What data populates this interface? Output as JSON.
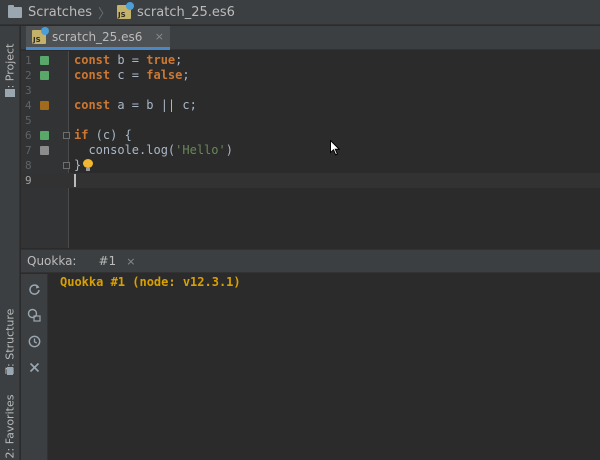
{
  "navbar": {
    "breadcrumb": [
      "Scratches",
      "scratch_25.es6"
    ]
  },
  "left_stripe": {
    "tabs": [
      "1: Project",
      "Z: Structure",
      "2: Favorites"
    ]
  },
  "editor": {
    "tab_label": "scratch_25.es6",
    "close_glyph": "×",
    "line_numbers": [
      "1",
      "2",
      "3",
      "4",
      "5",
      "6",
      "7",
      "8",
      "9"
    ],
    "lines": [
      {
        "kw": "const",
        "rest": " b = ",
        "kw2": "true",
        "tail": ";"
      },
      {
        "kw": "const",
        "rest": " c = ",
        "kw2": "false",
        "tail": ";"
      },
      {
        "text": ""
      },
      {
        "kw": "const",
        "rest": " a = b || c;"
      },
      {
        "text": ""
      },
      {
        "kw": "if",
        "rest": " (c) {"
      },
      {
        "pre": "  console.log(",
        "str": "'Hello'",
        "post": ")"
      },
      {
        "text": "}"
      },
      {
        "text": ""
      }
    ],
    "markers": [
      "green",
      "green",
      "",
      "orange",
      "",
      "green",
      "gray",
      "",
      ""
    ],
    "colors": {
      "keyword": "#cc7832",
      "string": "#6a8759",
      "text": "#a9b7c6"
    }
  },
  "quokka": {
    "panel_title": "Quokka:",
    "tab_label": "#1",
    "tab_close": "×",
    "output": "Quokka #1 (node: v12.3.1)",
    "toolbar_icons": [
      "refresh-icon",
      "log-search-icon",
      "clock-icon",
      "close-icon"
    ],
    "output_color": "#d9a000"
  }
}
